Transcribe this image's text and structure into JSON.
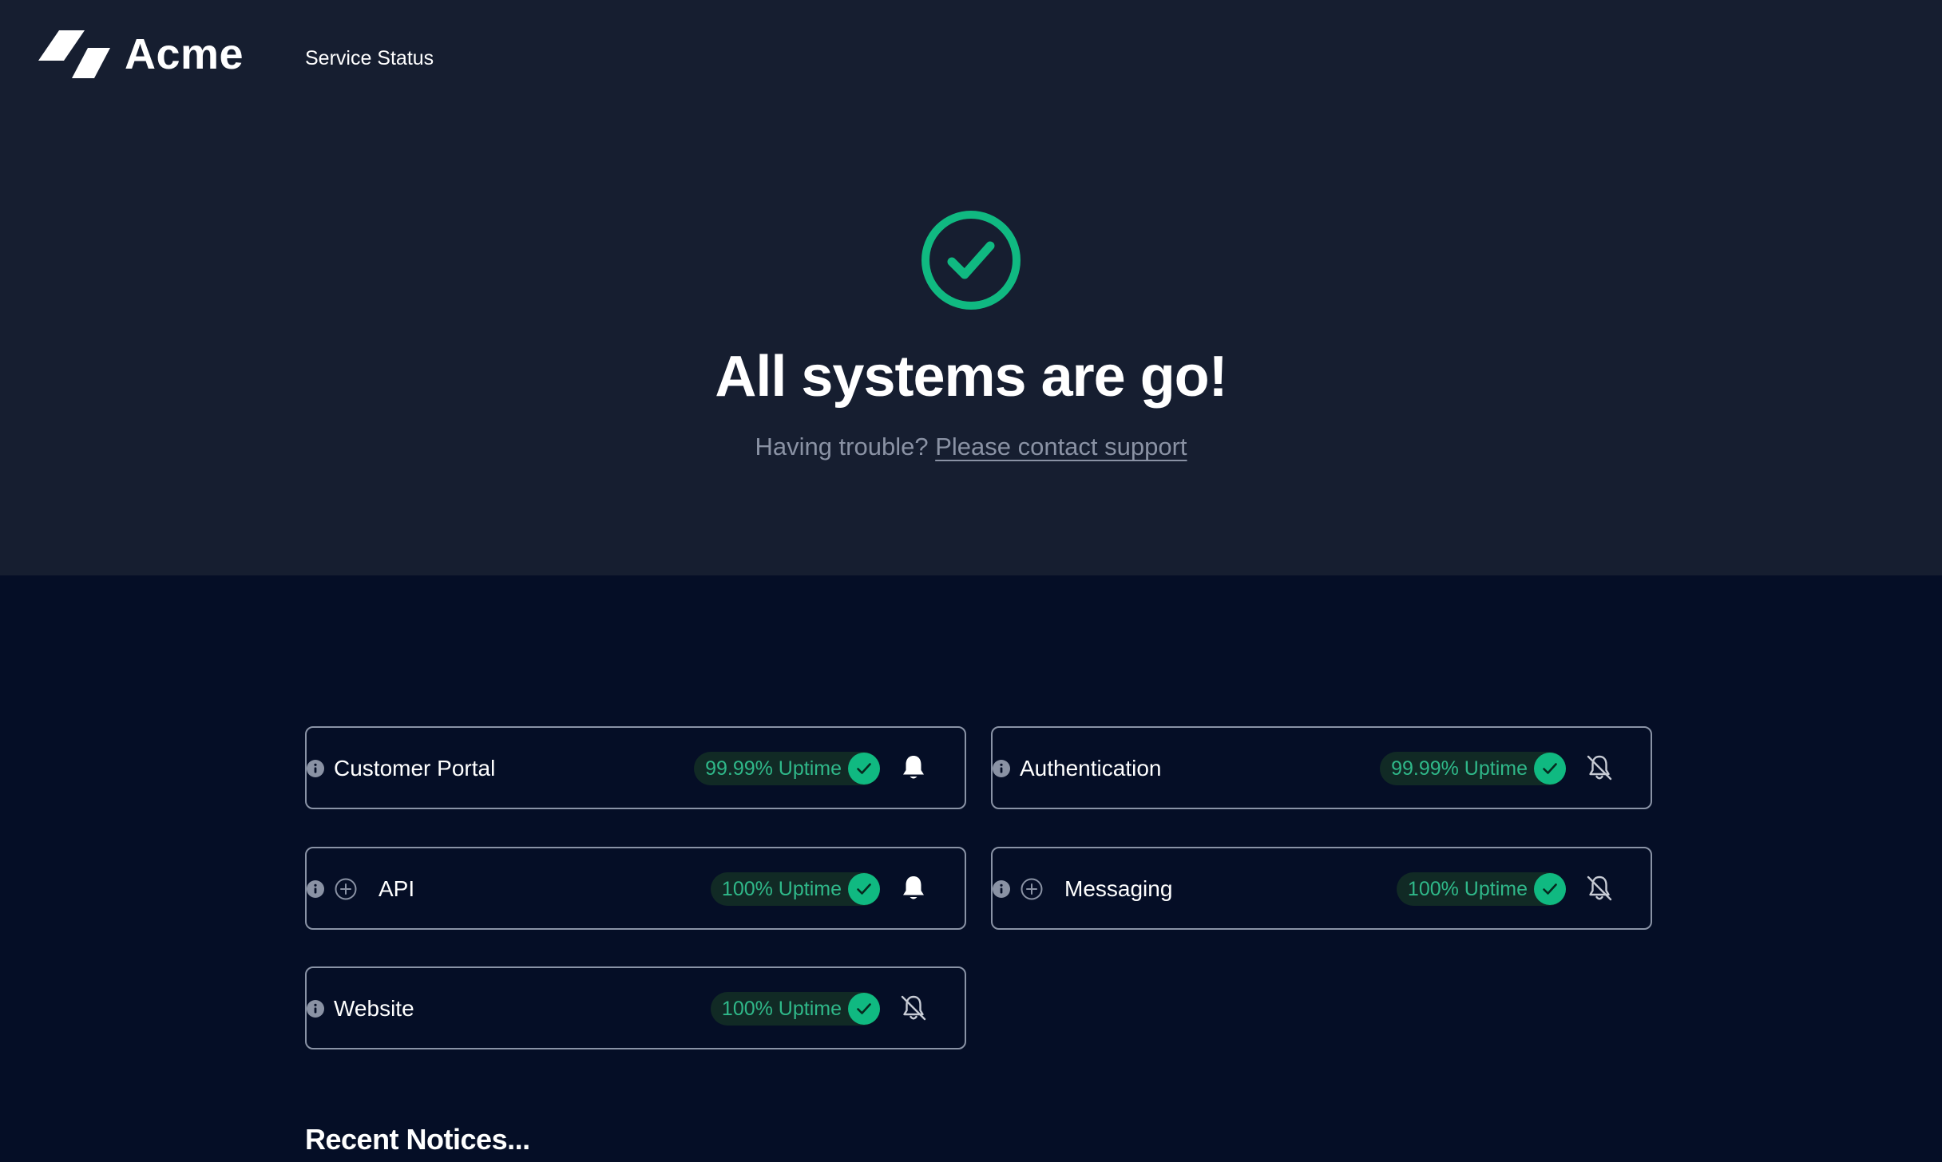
{
  "header": {
    "logo_text": "Acme",
    "nav_link": "Service Status"
  },
  "hero": {
    "status_icon": "check-circle-icon",
    "headline": "All systems are go!",
    "subline_prefix": "Having trouble? ",
    "support_link": "Please contact support"
  },
  "colors": {
    "hero_bg": "#161e30",
    "page_bg": "#050e26",
    "accent_green": "#10b981",
    "uptime_text": "#2fb889",
    "card_border": "#8a93a6"
  },
  "services": [
    {
      "name": "Customer Portal",
      "uptime": "99.99% Uptime",
      "expandable": false,
      "notifications": "on"
    },
    {
      "name": "Authentication",
      "uptime": "99.99% Uptime",
      "expandable": false,
      "notifications": "off"
    },
    {
      "name": "API",
      "uptime": "100% Uptime",
      "expandable": true,
      "notifications": "on"
    },
    {
      "name": "Messaging",
      "uptime": "100% Uptime",
      "expandable": true,
      "notifications": "off"
    },
    {
      "name": "Website",
      "uptime": "100% Uptime",
      "expandable": false,
      "notifications": "off"
    }
  ],
  "notices": {
    "title": "Recent Notices..."
  }
}
